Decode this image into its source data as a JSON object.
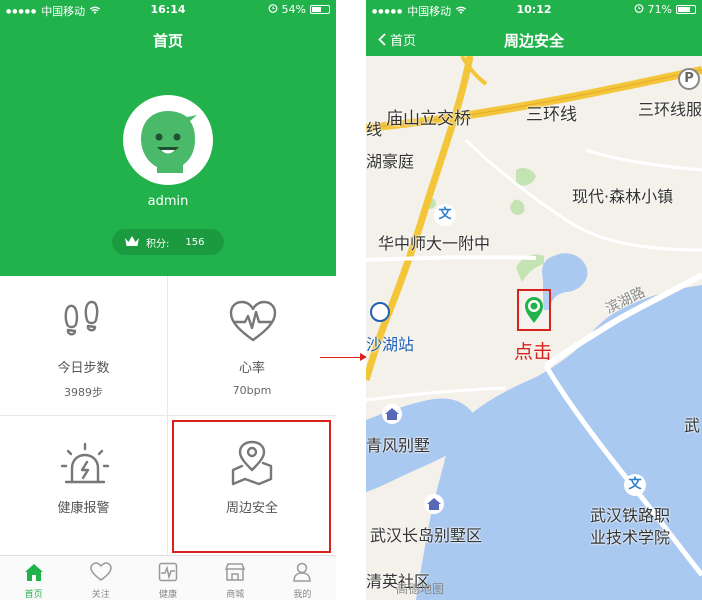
{
  "left_screen": {
    "status_bar": {
      "carrier": "中国移动",
      "time": "16:14",
      "battery": "54%",
      "battery_level": 0.54
    },
    "title": "首页",
    "username": "admin",
    "points_label": "积分:",
    "points_value": "156",
    "cards": [
      {
        "label": "今日步数",
        "value": "3989步",
        "icon": "footprints-icon"
      },
      {
        "label": "心率",
        "value": "70bpm",
        "icon": "heart-rate-icon"
      },
      {
        "label": "健康报警",
        "value": "",
        "icon": "alarm-siren-icon"
      },
      {
        "label": "周边安全",
        "value": "",
        "icon": "map-pin-icon"
      }
    ],
    "tabs": [
      {
        "label": "首页",
        "icon": "home-icon",
        "active": true
      },
      {
        "label": "关注",
        "icon": "heart-icon",
        "active": false
      },
      {
        "label": "健康",
        "icon": "health-chart-icon",
        "active": false
      },
      {
        "label": "商城",
        "icon": "shop-icon",
        "active": false
      },
      {
        "label": "我的",
        "icon": "user-icon",
        "active": false
      }
    ]
  },
  "right_screen": {
    "status_bar": {
      "carrier": "中国移动",
      "time": "10:12",
      "battery": "71%",
      "battery_level": 0.71
    },
    "back_label": "首页",
    "title": "周边安全",
    "map_labels": {
      "bridge": "庙山立交桥",
      "ring_road": "三环线",
      "ring_road_right": "三环线服",
      "xian": "线",
      "garden": "湖豪庭",
      "town": "现代·森林小镇",
      "school": "华中师大一附中",
      "lake_road": "滨湖路",
      "station": "沙湖站",
      "green_villa": "青风别墅",
      "wu": "武",
      "college_line1": "武汉铁路职",
      "college_line2": "业技术学院",
      "island_villa": "武汉长岛别墅区",
      "community": "清英社区",
      "watermark": "高德地图"
    },
    "annotation": "点击"
  },
  "colors": {
    "brand_green": "#22b24c",
    "highlight_red": "#d9221c"
  }
}
